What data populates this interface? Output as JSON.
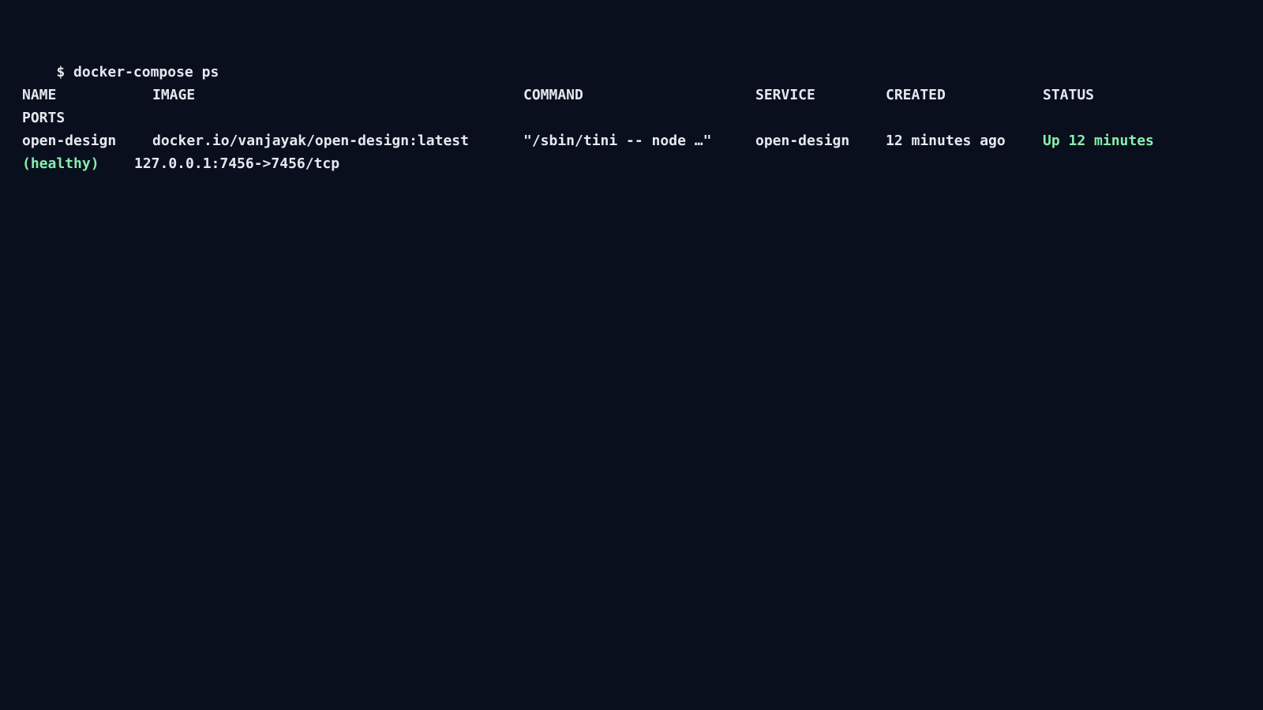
{
  "terminal": {
    "prompt_symbol": "$",
    "command": "docker-compose ps",
    "headers": {
      "name": "NAME",
      "image": "IMAGE",
      "command": "COMMAND",
      "service": "SERVICE",
      "created": "CREATED",
      "status": "STATUS",
      "ports": "PORTS"
    },
    "rows": [
      {
        "name": "open-design",
        "image": "docker.io/vanjayak/open-design:latest",
        "command": "\"/sbin/tini -- node …\"",
        "service": "open-design",
        "created": "12 minutes ago",
        "status": "Up 12 minutes",
        "status_health": "(healthy)",
        "ports": "127.0.0.1:7456->7456/tcp"
      }
    ],
    "colors": {
      "background": "#0a0f1e",
      "foreground": "#e6e8ee",
      "status_ok": "#86efac"
    }
  }
}
